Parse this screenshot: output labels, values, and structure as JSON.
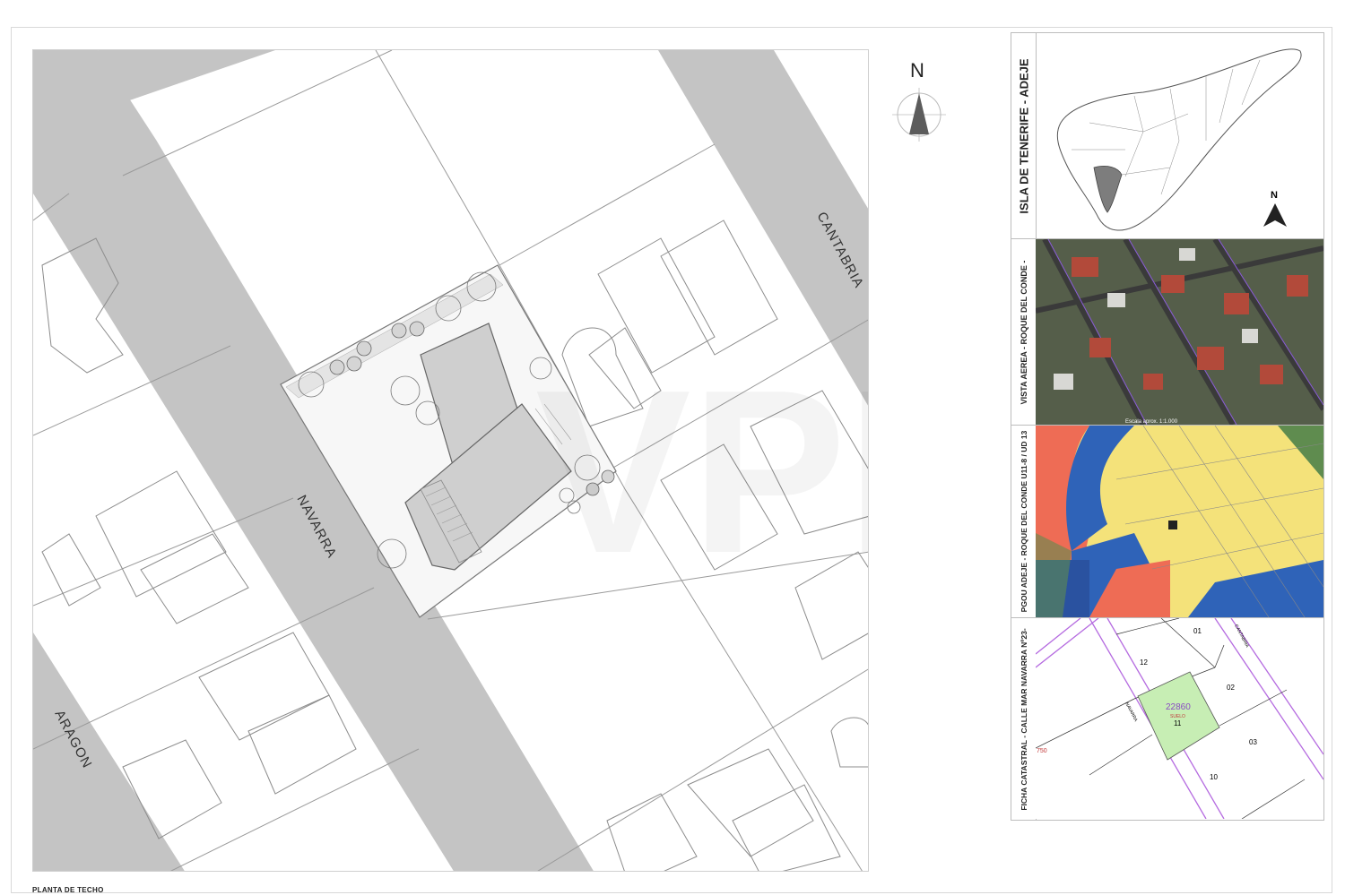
{
  "plan": {
    "title": "PLANTA DE TECHO",
    "streets": {
      "navarra": "NAVARRA",
      "cantabria": "CANTABRIA",
      "aragon": "ARAGON"
    },
    "north_label": "N",
    "watermark": "VPI"
  },
  "side_panels": [
    {
      "label": "ISLA DE TENERIFE - ADEJE"
    },
    {
      "label": "VISTA AEREA - ROQUE DEL CONDE -",
      "caption": "Escala aprox. 1:1.000"
    },
    {
      "label": "PGOU ADEJE - ROQUE DEL CONDE U11-8 / UD 13"
    },
    {
      "label": "FICHA CATASTRAL - CALLE MAR NAVARRA Nº23-"
    }
  ],
  "tenerife_map": {
    "north_label": "N"
  },
  "cadastral": {
    "parcel_ref": "22860",
    "parcel_tag": "SUELO",
    "plots": [
      "01",
      "02",
      "03",
      "10",
      "11",
      "12"
    ],
    "edge_ref": "750",
    "street_navarra": "NAVARRA",
    "street_cantabria": "CANTABRIA"
  },
  "colors": {
    "street_fill": "#c4c4c4",
    "parcel_green": "#c7eeb4",
    "parcel_ref_purple": "#8a4cc4",
    "cadastral_lines": "#b56be0",
    "pgou_yellow": "#f4e27a",
    "pgou_blue": "#2f63b8",
    "pgou_red": "#ee6c55",
    "pgou_green": "#5f8c4f",
    "map_highlight": "#7d7d7d"
  },
  "icons": [
    "north-arrow-icon"
  ]
}
